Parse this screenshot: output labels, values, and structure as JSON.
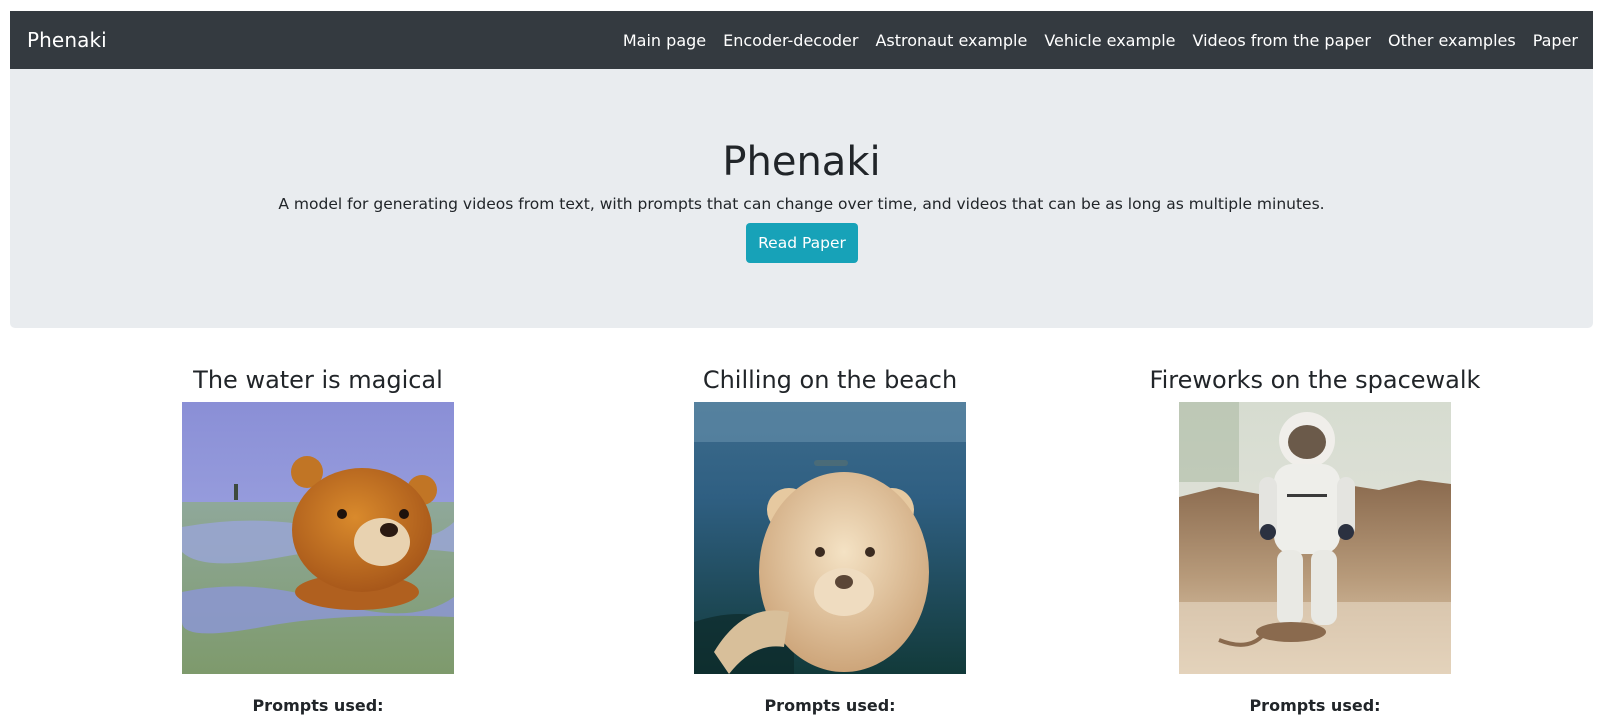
{
  "navbar": {
    "brand": "Phenaki",
    "links": [
      "Main page",
      "Encoder-decoder",
      "Astronaut example",
      "Vehicle example",
      "Videos from the paper",
      "Other examples",
      "Paper"
    ]
  },
  "hero": {
    "title": "Phenaki",
    "lead": "A model for generating videos from text, with prompts that can change over time, and videos that can be as long as multiple minutes.",
    "button_label": "Read Paper"
  },
  "examples": [
    {
      "title": "The water is magical",
      "prompts_label": "Prompts used:"
    },
    {
      "title": "Chilling on the beach",
      "prompts_label": "Prompts used:"
    },
    {
      "title": "Fireworks on the spacewalk",
      "prompts_label": "Prompts used:"
    }
  ],
  "colors": {
    "navbar_bg": "#343a40",
    "jumbotron_bg": "#e9ecef",
    "button_bg": "#17a2b8"
  }
}
